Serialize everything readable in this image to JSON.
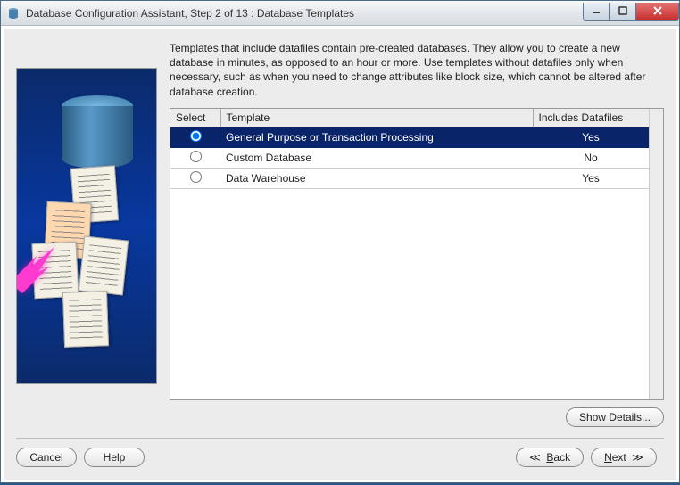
{
  "window": {
    "title": "Database Configuration Assistant, Step 2 of 13 : Database Templates"
  },
  "description": "Templates that include datafiles contain pre-created databases. They allow you to create a new database in minutes, as opposed to an hour or more. Use templates without datafiles only when necessary, such as when you need to change attributes like block size, which cannot be altered after database creation.",
  "table": {
    "headers": {
      "select": "Select",
      "template": "Template",
      "includes": "Includes Datafiles"
    },
    "rows": [
      {
        "template": "General Purpose or Transaction Processing",
        "includes": "Yes",
        "selected": true
      },
      {
        "template": "Custom Database",
        "includes": "No",
        "selected": false
      },
      {
        "template": "Data Warehouse",
        "includes": "Yes",
        "selected": false
      }
    ]
  },
  "buttons": {
    "show_details": "Show Details...",
    "cancel": "Cancel",
    "help": "Help",
    "back": "Back",
    "next": "Next"
  }
}
